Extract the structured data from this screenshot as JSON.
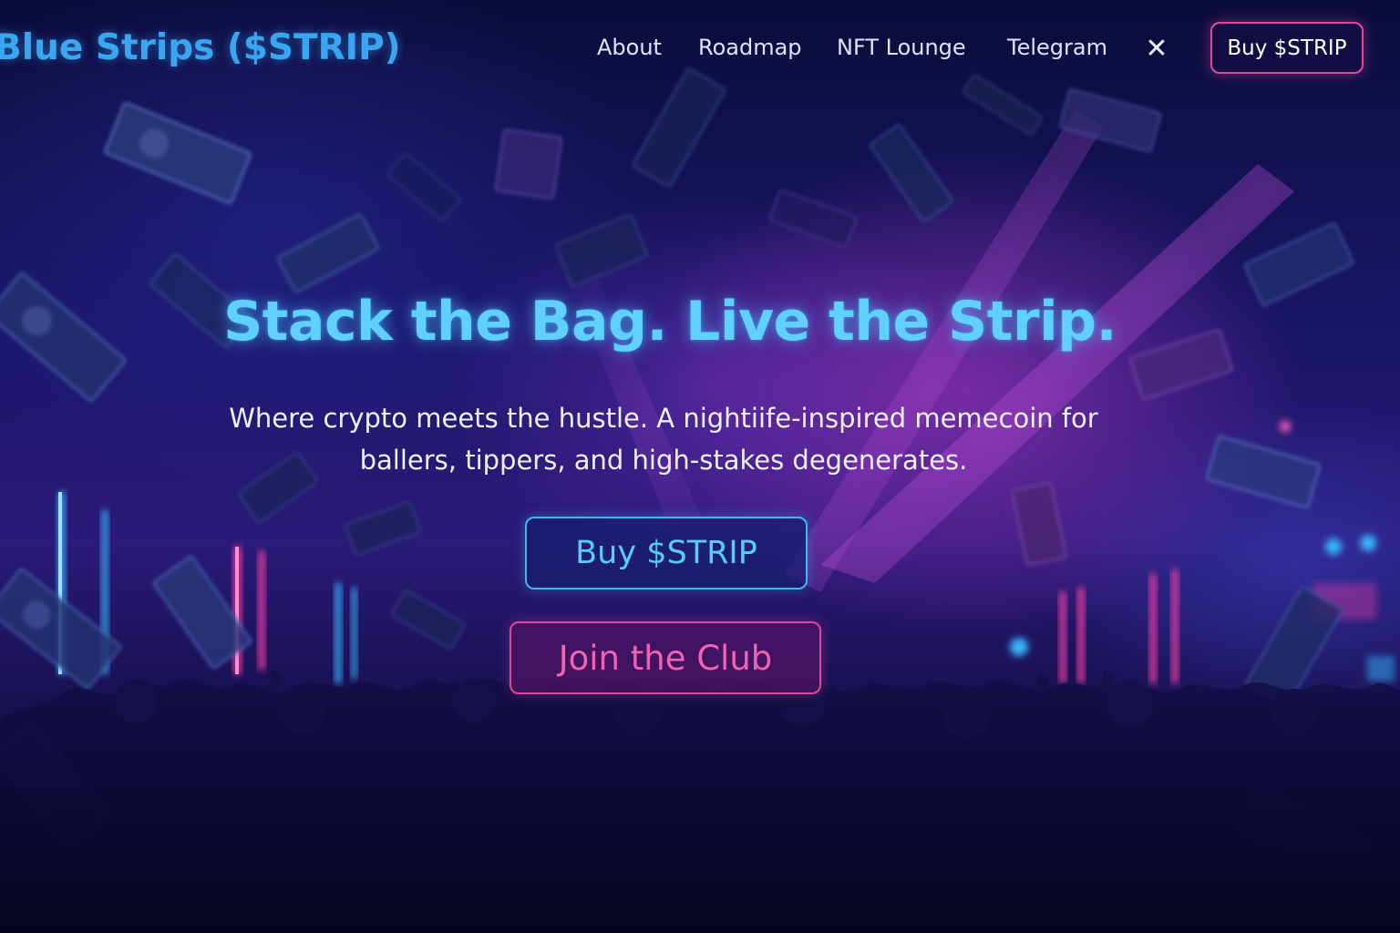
{
  "nav": {
    "brand": "Blue Strips ($STRIP)",
    "links": [
      {
        "label": "About"
      },
      {
        "label": "Roadmap"
      },
      {
        "label": "NFT Lounge"
      },
      {
        "label": "Telegram"
      }
    ],
    "close_icon": "close-icon",
    "close_glyph": "✕",
    "buy_label": "Buy $STRIP"
  },
  "hero": {
    "title": "Stack the Bag. Live the Strip.",
    "subtitle": "Where crypto meets the hustle. A nightiife-inspired memecoin for ballers, tippers, and high-stakes degenerates.",
    "primary_button": "Buy $STRIP",
    "secondary_button": "Join the Club"
  },
  "colors": {
    "brand_blue": "#3aa6f2",
    "title_cyan": "#5fd0ff",
    "accent_pink": "#e0479c",
    "background_navy": "#0a0c3a"
  }
}
